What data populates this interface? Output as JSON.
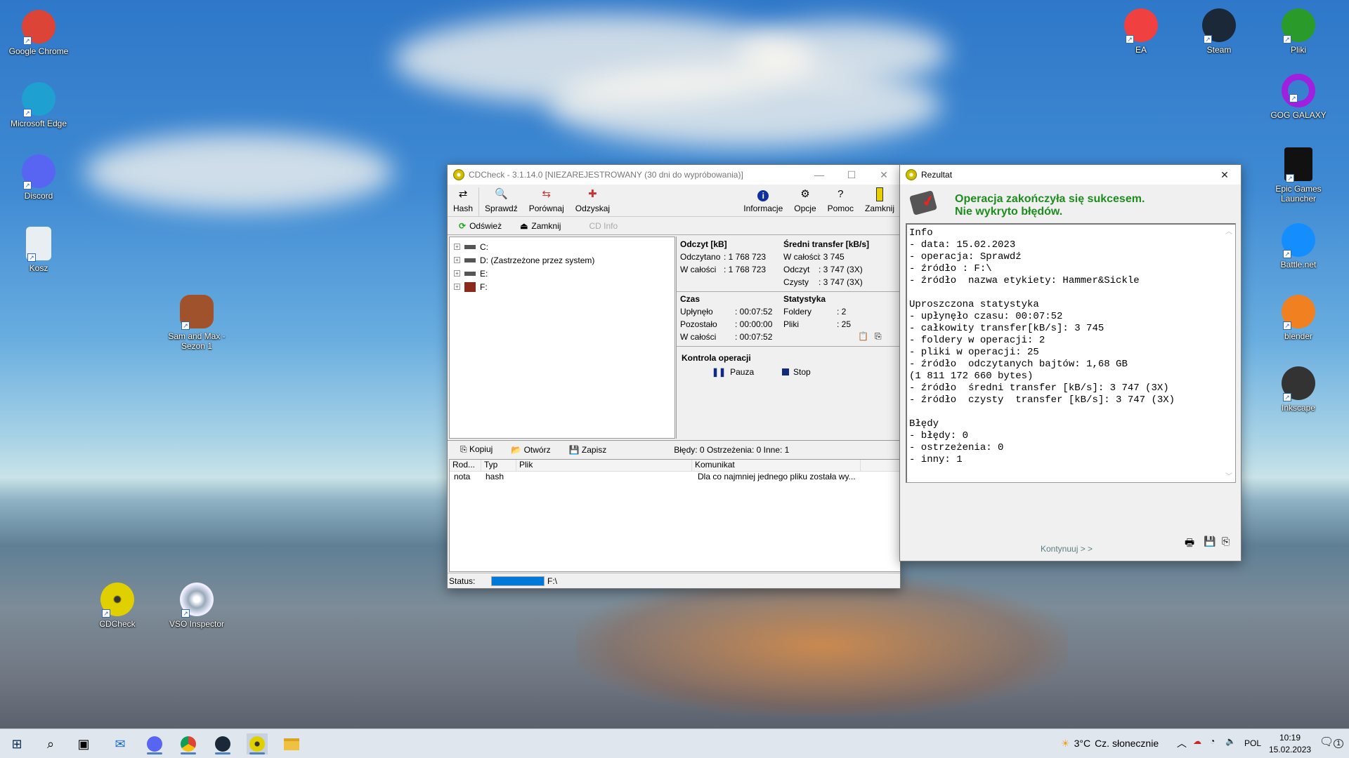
{
  "desktop": {
    "icons_left": [
      {
        "label": "Google Chrome",
        "icon": "chrome-icon",
        "color": "#db4437"
      },
      {
        "label": "Microsoft Edge",
        "icon": "edge-icon",
        "color": "#1ea0d0"
      },
      {
        "label": "Discord",
        "icon": "discord-icon",
        "color": "#5865f2"
      },
      {
        "label": "Kosz",
        "icon": "recycle-bin-icon",
        "color": "#e8eef2"
      }
    ],
    "icons_mid": [
      {
        "label": "Sam and Max - Sezon 1",
        "icon": "sam-and-max-icon"
      },
      {
        "label": "CDCheck",
        "icon": "cdcheck-icon"
      },
      {
        "label": "VSO Inspector",
        "icon": "vso-inspector-icon"
      }
    ],
    "icons_right": [
      {
        "label": "EA",
        "icon": "ea-icon",
        "color": "#f04040"
      },
      {
        "label": "Steam",
        "icon": "steam-icon",
        "color": "#1b2838"
      },
      {
        "label": "Pliki",
        "icon": "tree-icon",
        "color": "#2a9a2a"
      },
      {
        "label": "GOG GALAXY",
        "icon": "gog-galaxy-icon",
        "color": "#a020e0"
      },
      {
        "label": "Epic Games Launcher",
        "icon": "epic-games-icon",
        "color": "#111111"
      },
      {
        "label": "Battle.net",
        "icon": "battlenet-icon",
        "color": "#148eff"
      },
      {
        "label": "blender",
        "icon": "blender-icon",
        "color": "#f08020"
      },
      {
        "label": "Inkscape",
        "icon": "inkscape-icon",
        "color": "#333333"
      }
    ]
  },
  "cdcheck": {
    "title": "CDCheck - 3.1.14.0 [NIEZAREJESTROWANY (30 dni do wypróbowania)]",
    "toolbar_left": [
      "Hash",
      "Sprawdź",
      "Porównaj",
      "Odzyskaj"
    ],
    "toolbar_right": [
      "Informacje",
      "Opcje",
      "Pomoc",
      "Zamknij"
    ],
    "sub": {
      "refresh": "Odśwież",
      "close": "Zamknij",
      "cdinfo": "CD Info"
    },
    "tree": [
      "C:",
      "D: (Zastrzeżone przez system)",
      "E:",
      "F:"
    ],
    "read": {
      "heading": "Odczyt [kB]",
      "rows": [
        [
          "Odczytano",
          "1 768 723"
        ],
        [
          "W całości",
          "1 768 723"
        ]
      ]
    },
    "transfer": {
      "heading": "Średni transfer [kB/s]",
      "rows": [
        [
          "W całości",
          "3 745"
        ],
        [
          "Odczyt",
          "3 747 (3X)"
        ],
        [
          "Czysty",
          "3 747 (3X)"
        ]
      ]
    },
    "time": {
      "heading": "Czas",
      "rows": [
        [
          "Upłynęło",
          "00:07:52"
        ],
        [
          "Pozostało",
          "00:00:00"
        ],
        [
          "W całości",
          "00:07:52"
        ]
      ]
    },
    "stats": {
      "heading": "Statystyka",
      "rows": [
        [
          "Foldery",
          "2"
        ],
        [
          "Pliki",
          "25"
        ]
      ]
    },
    "control": {
      "heading": "Kontrola operacji",
      "pause": "Pauza",
      "stop": "Stop"
    },
    "log_toolbar": {
      "copy": "Kopiuj",
      "open": "Otwórz",
      "save": "Zapisz",
      "summary": "Błędy: 0 Ostrzeżenia: 0 Inne: 1"
    },
    "log_columns": [
      "Rod...",
      "Typ",
      "Plik",
      "Komunikat"
    ],
    "log_rows": [
      [
        "nota",
        "hash",
        "",
        "Dla co najmniej jednego pliku została wy..."
      ]
    ],
    "status": {
      "label": "Status:",
      "path": "F:\\",
      "progress_percent": 100,
      "progress_color": "#0078d7"
    }
  },
  "result": {
    "title": "Rezultat",
    "msg1": "Operacja zakończyła się sukcesem.",
    "msg2": "Nie wykryto błędów.",
    "msg_color": "#1e8c1e",
    "text": "Info\n- data: 15.02.2023\n- operacja: Sprawdź\n- źródło : F:\\\n- źródło  nazwa etykiety: Hammer&Sickle\n\nUproszczona statystyka\n- upłynęło czasu: 00:07:52\n- całkowity transfer[kB/s]: 3 745\n- foldery w operacji: 2\n- pliki w operacji: 25\n- źródło  odczytanych bajtów: 1,68 GB\n(1 811 172 660 bytes)\n- źródło  średni transfer [kB/s]: 3 747 (3X)\n- źródło  czysty  transfer [kB/s]: 3 747 (3X)\n\nBłędy\n- błędy: 0\n- ostrzeżenia: 0\n- inny: 1",
    "continue": "Kontynuuj > >"
  },
  "taskbar": {
    "weather": "3°C",
    "weather_desc": "Cz. słonecznie",
    "lang": "POL",
    "time": "10:19",
    "date": "15.02.2023",
    "notifications": "1"
  }
}
